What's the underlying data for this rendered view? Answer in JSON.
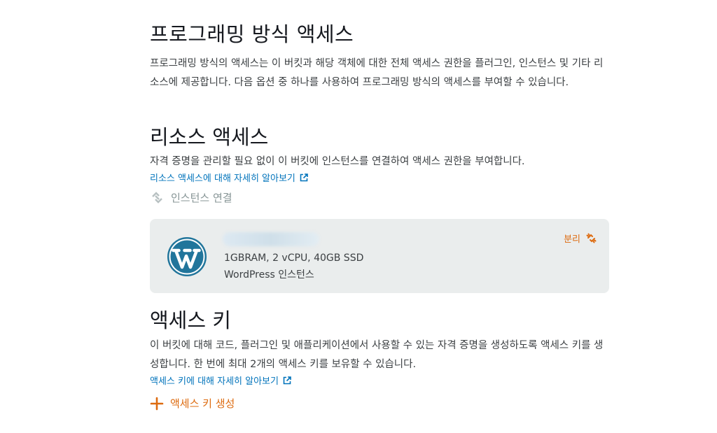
{
  "programmatic": {
    "title": "프로그래밍 방식 액세스",
    "description": "프로그래밍 방식의 액세스는 이 버킷과 해당 객체에 대한 전체 액세스 권한을 플러그인, 인스턴스 및 기타 리소스에 제공합니다. 다음 옵션 중 하나를 사용하여 프로그래밍 방식의 액세스를 부여할 수 있습니다."
  },
  "resource_access": {
    "title": "리소스 액세스",
    "description": "자격 증명을 관리할 필요 없이 이 버킷에 인스턴스를 연결하여 액세스 권한을 부여합니다.",
    "learn_more": "리소스 액세스에 대해 자세히 알아보기",
    "attach_label": "인스턴스 연결"
  },
  "instance": {
    "spec": "1GBRAM, 2 vCPU, 40GB SSD",
    "type": "WordPress 인스턴스",
    "detach_label": "분리",
    "colors": {
      "card_bg": "#eaeded",
      "logo": "#21759b"
    }
  },
  "access_keys": {
    "title": "액세스 키",
    "description": "이 버킷에 대해 코드, 플러그인 및 애플리케이션에서 사용할 수 있는 자격 증명을 생성하도록 액세스 키를 생성합니다. 한 번에 최대 2개의 액세스 키를 보유할 수 있습니다.",
    "learn_more": "액세스 키에 대해 자세히 알아보기",
    "create_label": "액세스 키 생성"
  },
  "colors": {
    "link": "#0073bb",
    "accent": "#dd6b10",
    "disabled": "#879596"
  }
}
